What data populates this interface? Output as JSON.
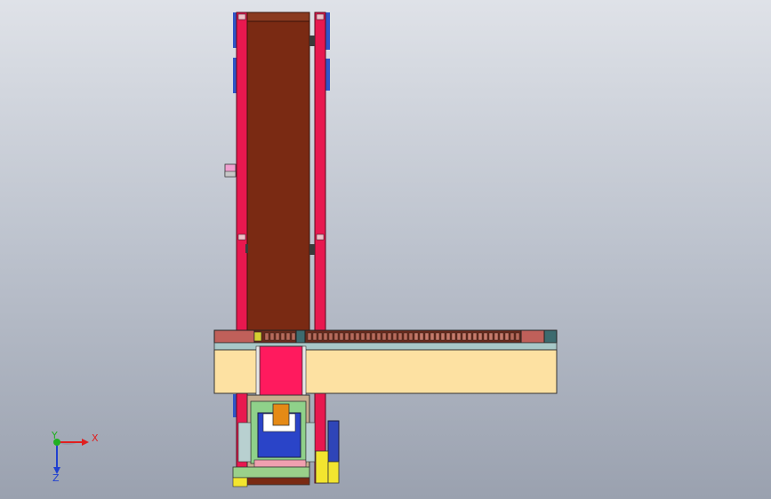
{
  "viewport": {
    "background_top": "#dfe2e8",
    "background_bottom": "#9aa1af"
  },
  "model": {
    "colors": {
      "rail": "#e8184f",
      "belt": "#7a2a13",
      "crossbar": "#fde1a2",
      "bracket": "#2f55c8",
      "drive_pink": "#e8184f",
      "orange_block": "#e58a15",
      "chain": "#6a2a1c",
      "chain_end": "#c0605a",
      "teal_cap": "#3d6b6f",
      "yellow_pad": "#f3e52f",
      "green_plate": "#8fd18a"
    }
  },
  "triad": {
    "x_label": "X",
    "y_label": "Y",
    "z_label": "Z",
    "x_color": "#e02020",
    "y_color": "#20b020",
    "z_color": "#2040d0"
  }
}
